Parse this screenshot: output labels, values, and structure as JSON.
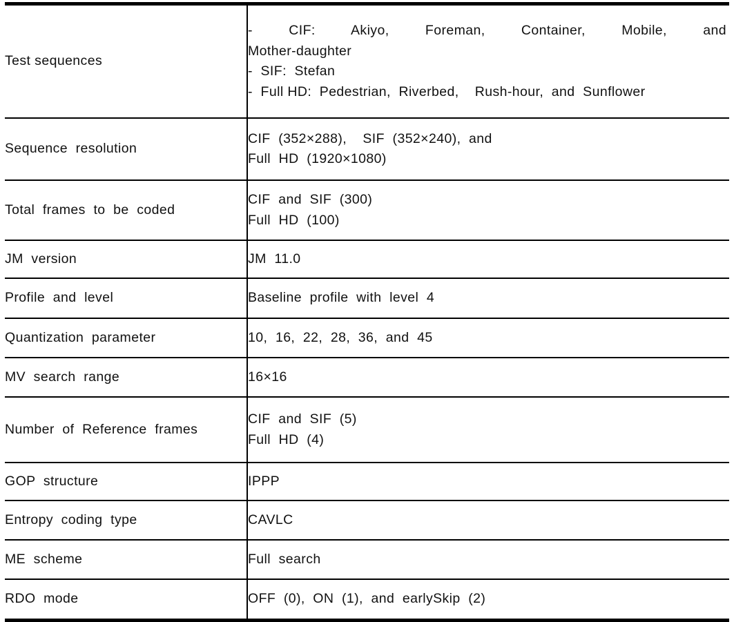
{
  "table": {
    "rows": [
      {
        "label": "Test sequences",
        "value_lines": [
          "-  CIF:  Akiyo,  Foreman,  Container,  Mobile,  and",
          "Mother-daughter",
          "-  SIF:  Stefan",
          "-  Full HD:  Pedestrian,  Riverbed,    Rush-hour,  and  Sunflower"
        ]
      },
      {
        "label": "Sequence  resolution",
        "value_lines": [
          "CIF  (352×288),    SIF  (352×240),  and",
          "Full  HD  (1920×1080)"
        ]
      },
      {
        "label": "Total  frames  to  be  coded",
        "value_lines": [
          "CIF  and  SIF  (300)",
          "Full  HD  (100)"
        ]
      },
      {
        "label": "JM  version",
        "value_lines": [
          "JM  11.0"
        ]
      },
      {
        "label": "Profile  and  level",
        "value_lines": [
          "Baseline  profile  with  level  4"
        ]
      },
      {
        "label": "Quantization  parameter",
        "value_lines": [
          "10,  16,  22,  28,  36,  and  45"
        ]
      },
      {
        "label": "MV  search  range",
        "value_lines": [
          "16×16"
        ]
      },
      {
        "label": "Number  of  Reference  frames",
        "value_lines": [
          "CIF  and  SIF  (5)",
          "Full  HD  (4)"
        ]
      },
      {
        "label": "GOP  structure",
        "value_lines": [
          "IPPP"
        ]
      },
      {
        "label": "Entropy  coding  type",
        "value_lines": [
          "CAVLC"
        ]
      },
      {
        "label": "ME  scheme",
        "value_lines": [
          "Full  search"
        ]
      },
      {
        "label": "RDO  mode",
        "value_lines": [
          "OFF  (0),  ON  (1),  and  earlySkip  (2)"
        ]
      }
    ]
  },
  "style": {
    "rule_color": "#000000",
    "text_color": "#111111",
    "background": "#ffffff"
  }
}
